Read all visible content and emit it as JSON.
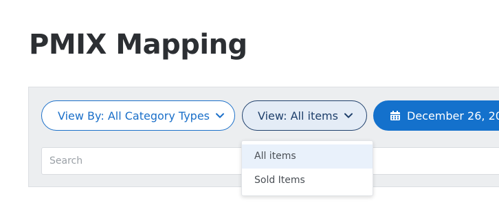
{
  "page": {
    "title": "PMIX Mapping"
  },
  "filters": {
    "category_button": "View By: All Category Types",
    "view_button": "View: All items",
    "date_button": "December 26, 20"
  },
  "search": {
    "placeholder": "Search",
    "value": ""
  },
  "view_dropdown": {
    "options": [
      "All items",
      "Sold Items"
    ],
    "highlighted": "All items"
  },
  "colors": {
    "accent": "#1a6fc9",
    "date_button_bg": "#1471cc",
    "view_button_border": "#1e3f6b",
    "panel_bg": "#eceef0",
    "title": "#2c2f33"
  },
  "icons": [
    "chevron-down-icon",
    "calendar-icon"
  ]
}
